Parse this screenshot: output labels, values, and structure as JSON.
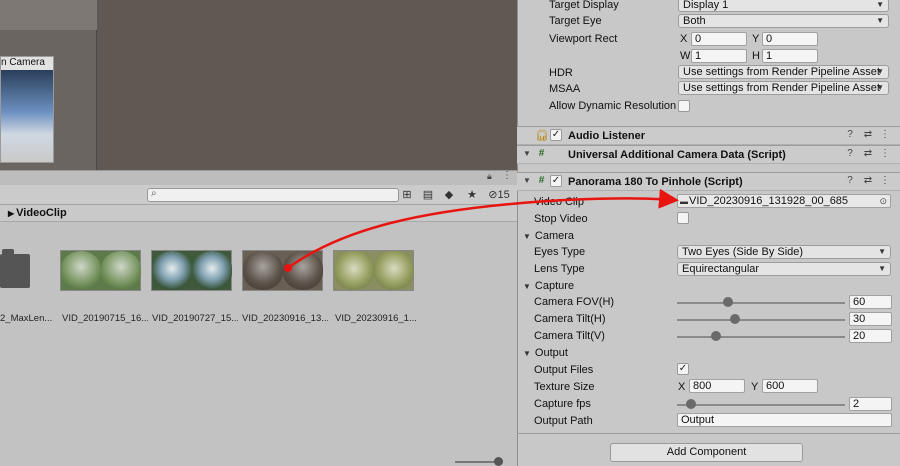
{
  "scene": {
    "camera_preview_title": "n Camera"
  },
  "project": {
    "hidden_count": "15",
    "breadcrumb": "VideoClip",
    "items": [
      {
        "label": "2_MaxLen..."
      },
      {
        "label": "VID_20190715_16..."
      },
      {
        "label": "VID_20190727_15..."
      },
      {
        "label": "VID_20230916_13..."
      },
      {
        "label": "VID_20230916_1..."
      }
    ]
  },
  "inspector": {
    "camera": {
      "target_display_label": "Target Display",
      "target_display_value": "Display 1",
      "target_eye_label": "Target Eye",
      "target_eye_value": "Both",
      "viewport_rect_label": "Viewport Rect",
      "x_label": "X",
      "x_value": "0",
      "y_label": "Y",
      "y_value": "0",
      "w_label": "W",
      "w_value": "1",
      "h_label": "H",
      "h_value": "1",
      "hdr_label": "HDR",
      "hdr_value": "Use settings from Render Pipeline Asset",
      "msaa_label": "MSAA",
      "msaa_value": "Use settings from Render Pipeline Asset",
      "allow_dynamic_resolution_label": "Allow Dynamic Resolution"
    },
    "components": {
      "audio_listener": "Audio Listener",
      "universal_camera_data": "Universal Additional Camera Data (Script)",
      "panorama": "Panorama 180 To Pinhole (Script)"
    },
    "panorama": {
      "video_clip_label": "Video Clip",
      "video_clip_value": "VID_20230916_131928_00_685",
      "stop_video_label": "Stop Video",
      "camera_section": "Camera",
      "eyes_type_label": "Eyes Type",
      "eyes_type_value": "Two Eyes (Side By Side)",
      "lens_type_label": "Lens Type",
      "lens_type_value": "Equirectangular",
      "capture_section": "Capture",
      "camera_fov_label": "Camera FOV(H)",
      "camera_fov_value": "60",
      "camera_tilt_h_label": "Camera Tilt(H)",
      "camera_tilt_h_value": "30",
      "camera_tilt_v_label": "Camera Tilt(V)",
      "camera_tilt_v_value": "20",
      "output_section": "Output",
      "output_files_label": "Output Files",
      "texture_size_label": "Texture Size",
      "texture_x_label": "X",
      "texture_x_value": "800",
      "texture_y_label": "Y",
      "texture_y_value": "600",
      "capture_fps_label": "Capture fps",
      "capture_fps_value": "2",
      "output_path_label": "Output Path",
      "output_path_value": "Output"
    },
    "add_component": "Add Component"
  },
  "colors": {
    "annotation_arrow": "#e8140f"
  }
}
